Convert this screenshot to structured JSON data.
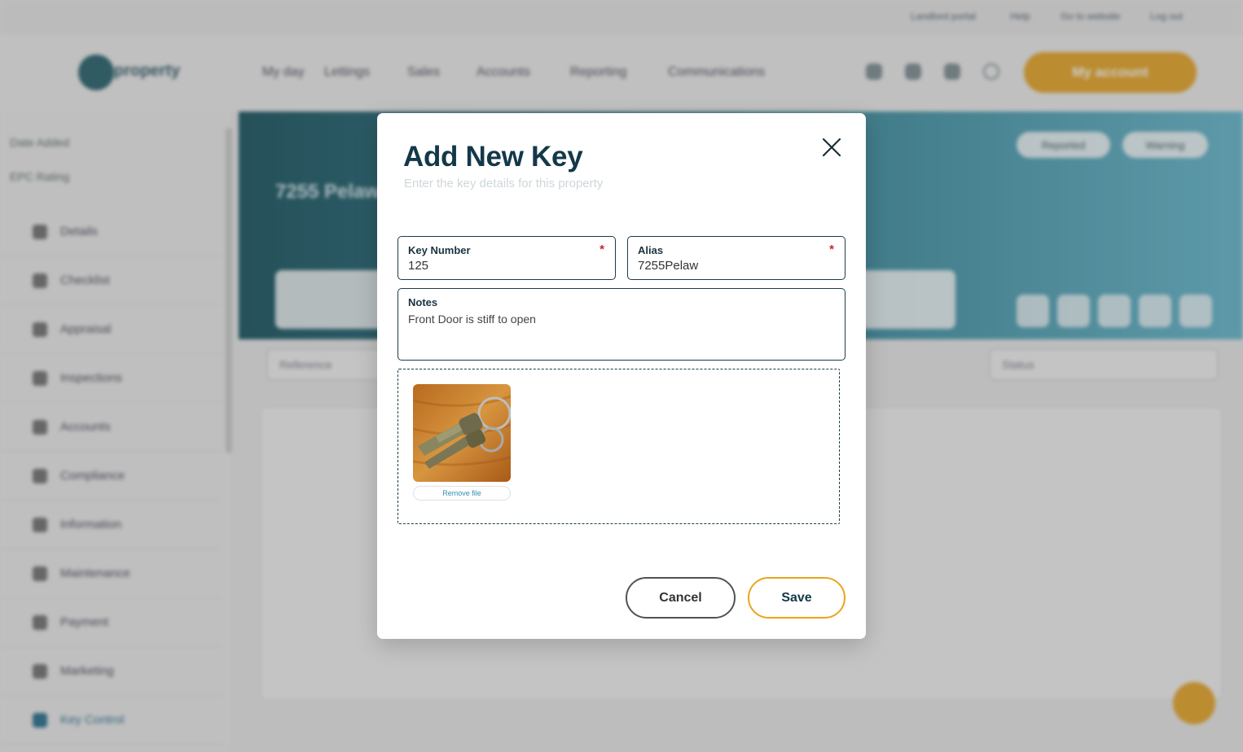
{
  "modal": {
    "title": "Add New Key",
    "subtitle": "Enter the key details for this property",
    "close_icon": "close-icon",
    "key_number": {
      "label": "Key Number",
      "required_mark": "*",
      "value": "125"
    },
    "alias": {
      "label": "Alias",
      "required_mark": "*",
      "value": "7255Pelaw"
    },
    "notes": {
      "label": "Notes",
      "value": "Front Door is stiff to open"
    },
    "attachment": {
      "image_icon": "key-photo",
      "remove_label": "Remove file"
    },
    "cancel_label": "Cancel",
    "save_label": "Save"
  },
  "background": {
    "util_links": [
      "Landlord portal",
      "Help",
      "Go to website",
      "Log out"
    ],
    "logo_text": "property",
    "nav": [
      "My day",
      "Lettings",
      "Sales",
      "Accounts",
      "Reporting",
      "Communications"
    ],
    "account_label": "My account",
    "sidebar_top": [
      "Date Added",
      "EPC Rating"
    ],
    "sidebar_items": [
      "Details",
      "Checklist",
      "Appraisal",
      "Inspections",
      "Accounts",
      "Compliance",
      "Information",
      "Maintenance",
      "Payment",
      "Marketing",
      "Key Control"
    ],
    "property_title": "7255 Pelaw",
    "pill_1": "Reported",
    "pill_2": "Warning",
    "filter_reference": "Reference",
    "filter_status": "Status"
  },
  "colors": {
    "brand_teal": "#13384a",
    "accent_yellow": "#e8a51b",
    "required_red": "#d21f2a",
    "link_blue": "#2e8fb3"
  }
}
